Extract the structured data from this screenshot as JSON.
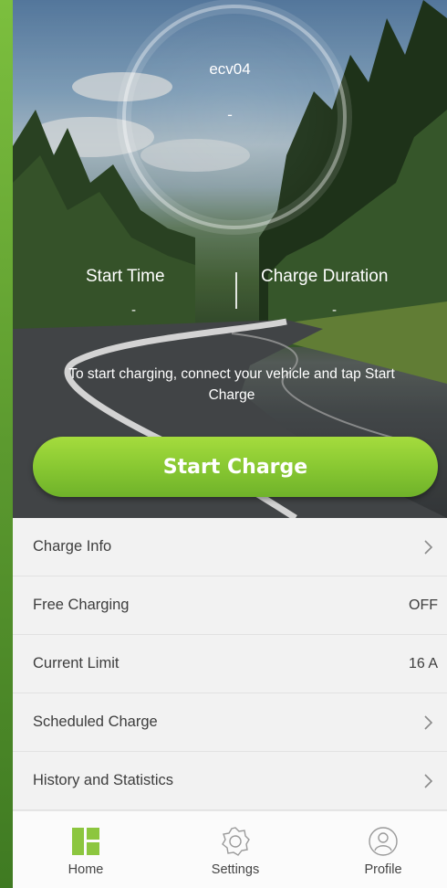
{
  "device": {
    "name": "ecv04",
    "status": "-"
  },
  "metrics": {
    "start_time_label": "Start Time",
    "start_time_value": "-",
    "duration_label": "Charge Duration",
    "duration_value": "-"
  },
  "hint": "To start charging, connect your vehicle and tap Start Charge",
  "start_button": "Start Charge",
  "list": {
    "items": [
      {
        "label": "Charge Info",
        "value": "",
        "chevron": true
      },
      {
        "label": "Free Charging",
        "value": "OFF",
        "chevron": false
      },
      {
        "label": "Current Limit",
        "value": "16 A",
        "chevron": false
      },
      {
        "label": "Scheduled Charge",
        "value": "",
        "chevron": true
      },
      {
        "label": "History and Statistics",
        "value": "",
        "chevron": true
      }
    ]
  },
  "nav": {
    "home": "Home",
    "settings": "Settings",
    "profile": "Profile",
    "active": "home"
  },
  "colors": {
    "accent": "#8cc63f",
    "nav_active": "#8cc63f",
    "nav_inactive": "#9a9a9a"
  },
  "icons": {
    "home": "home-grid-icon",
    "settings": "gear-icon",
    "profile": "user-icon",
    "chevron": "chevron-right-icon"
  }
}
